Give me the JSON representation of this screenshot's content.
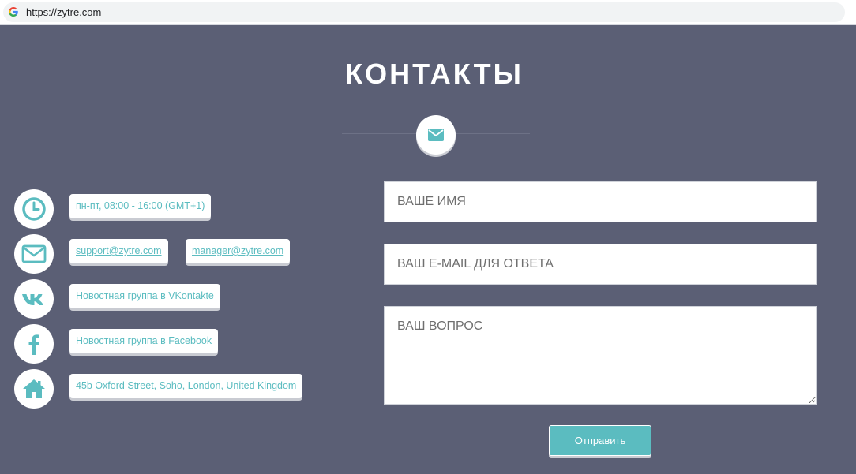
{
  "browser": {
    "url": "https://zytre.com"
  },
  "page": {
    "title": "КОНТАКТЫ"
  },
  "contacts": {
    "hours": "пн-пт, 08:00 - 16:00 (GMT+1)",
    "email_support": "support@zytre.com",
    "email_manager": "manager@zytre.com",
    "vk": "Новостная группа в VKontakte",
    "facebook": "Новостная группа в Facebook",
    "address": "45b Oxford Street, Soho, London, United Kingdom"
  },
  "form": {
    "name_placeholder": "ВАШЕ ИМЯ",
    "email_placeholder": "ВАШ E-MAIL ДЛЯ ОТВЕТА",
    "question_placeholder": "ВАШ ВОПРОС",
    "submit_label": "Отправить"
  },
  "colors": {
    "background": "#5b5f75",
    "accent": "#5bbcc0",
    "white": "#ffffff"
  },
  "icons": [
    "clock-icon",
    "envelope-icon",
    "vk-icon",
    "facebook-icon",
    "home-icon",
    "google-icon"
  ]
}
